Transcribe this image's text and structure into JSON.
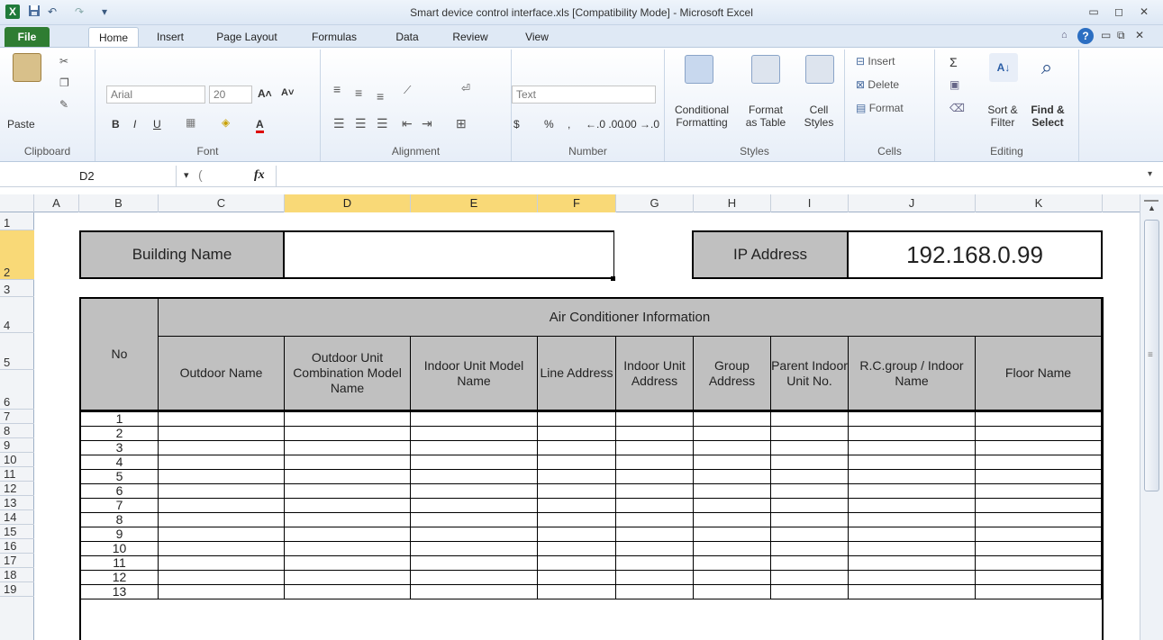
{
  "titlebar": {
    "title": "Smart device control interface.xls  [Compatibility Mode]  -  Microsoft Excel",
    "app_icon": "X",
    "save_icon": "floppy-icon",
    "undo_icon": "↶",
    "redo_icon": "↷",
    "customize_icon": "▾",
    "minimize": "▭",
    "restore": "◻",
    "close": "✕"
  },
  "tabs": [
    "File",
    "Home",
    "Insert",
    "Page Layout",
    "Formulas",
    "Data",
    "Review",
    "View"
  ],
  "ribbon": {
    "clipboard": {
      "label": "Clipboard",
      "paste": "Paste"
    },
    "font": {
      "label": "Font",
      "name": "Arial",
      "size": "20",
      "bold": "B",
      "italic": "I",
      "underline": "U",
      "grow": "A˄",
      "shrink": "A˅",
      "fontcolor": "A"
    },
    "alignment": {
      "label": "Alignment"
    },
    "number": {
      "label": "Number",
      "format": "Text",
      "currency": "$",
      "percent": "%",
      "comma": ",",
      "inc": "←.0 .00",
      "dec": ".00 →.0"
    },
    "styles": {
      "label": "Styles",
      "cond": [
        "Conditional",
        "Formatting"
      ],
      "format_table": [
        "Format",
        "as Table"
      ],
      "cell_styles": [
        "Cell",
        "Styles"
      ]
    },
    "cells": {
      "label": "Cells",
      "insert": "Insert",
      "delete": "Delete",
      "format": "Format"
    },
    "editing": {
      "label": "Editing",
      "sum": "Σ",
      "sort": [
        "Sort &",
        "Filter"
      ],
      "find": [
        "Find &",
        "Select"
      ]
    }
  },
  "formula_bar": {
    "name_box": "D2",
    "fx": "fx",
    "value": ""
  },
  "columns": [
    "A",
    "B",
    "C",
    "D",
    "E",
    "F",
    "G",
    "H",
    "I",
    "J",
    "K"
  ],
  "selected_column": "D",
  "rows": [
    "1",
    "2",
    "3",
    "4",
    "5",
    "6",
    "7",
    "8",
    "9",
    "10",
    "11",
    "12",
    "13",
    "14",
    "15",
    "16",
    "17",
    "18",
    "19"
  ],
  "selected_row": "2",
  "sheet": {
    "building_label": "Building Name",
    "building_value": "",
    "ip_label": "IP Address",
    "ip_value": "192.168.0.99",
    "table_title": "Air Conditioner Information",
    "no_header": "No",
    "headers": [
      "Outdoor Name",
      "Outdoor Unit Combination Model Name",
      "Indoor Unit Model Name",
      "Line Address",
      "Indoor Unit Address",
      "Group Address",
      "Parent Indoor Unit No.",
      "R.C.group / Indoor Name",
      "Floor Name"
    ],
    "numbers": [
      "1",
      "2",
      "3",
      "4",
      "5",
      "6",
      "7",
      "8",
      "9",
      "10",
      "11",
      "12",
      "13"
    ]
  }
}
